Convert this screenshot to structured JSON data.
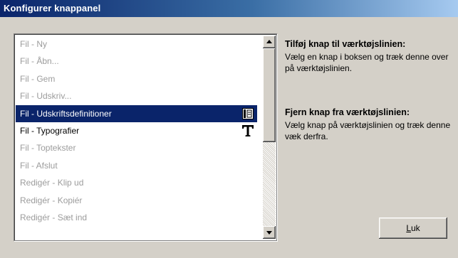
{
  "window": {
    "title": "Konfigurer knappanel"
  },
  "list": {
    "items": [
      {
        "label": "Fil  - Ny",
        "enabled": false,
        "selected": false,
        "icon": null
      },
      {
        "label": "Fil  - Åbn...",
        "enabled": false,
        "selected": false,
        "icon": null
      },
      {
        "label": "Fil  - Gem",
        "enabled": false,
        "selected": false,
        "icon": null
      },
      {
        "label": "Fil  - Udskriv...",
        "enabled": false,
        "selected": false,
        "icon": null
      },
      {
        "label": "Fil  - Udskriftsdefinitioner",
        "enabled": true,
        "selected": true,
        "icon": "page-setup-icon"
      },
      {
        "label": "Fil  - Typografier",
        "enabled": true,
        "selected": false,
        "icon": "typography-icon"
      },
      {
        "label": "Fil  - Toptekster",
        "enabled": false,
        "selected": false,
        "icon": null
      },
      {
        "label": "Fil  - Afslut",
        "enabled": false,
        "selected": false,
        "icon": null
      },
      {
        "label": "Redigér  - Klip ud",
        "enabled": false,
        "selected": false,
        "icon": null
      },
      {
        "label": "Redigér  - Kopiér",
        "enabled": false,
        "selected": false,
        "icon": null
      },
      {
        "label": "Redigér  - Sæt ind",
        "enabled": false,
        "selected": false,
        "icon": null
      }
    ]
  },
  "info": {
    "add_heading": "Tilføj knap til værktøjslinien:",
    "add_text": "Vælg en knap i boksen og træk denne over på værktøjslinien.",
    "remove_heading": "Fjern knap fra værktøjslinien:",
    "remove_text": "Vælg knap på værktøjslinien og træk denne væk derfra."
  },
  "buttons": {
    "close_mnemonic": "L",
    "close_rest": "uk"
  },
  "colors": {
    "selection": "#0a246a",
    "title_gradient_start": "#0a246a",
    "title_gradient_end": "#a6caf0",
    "face": "#d4d0c8",
    "disabled_text": "#9c9c9c"
  }
}
